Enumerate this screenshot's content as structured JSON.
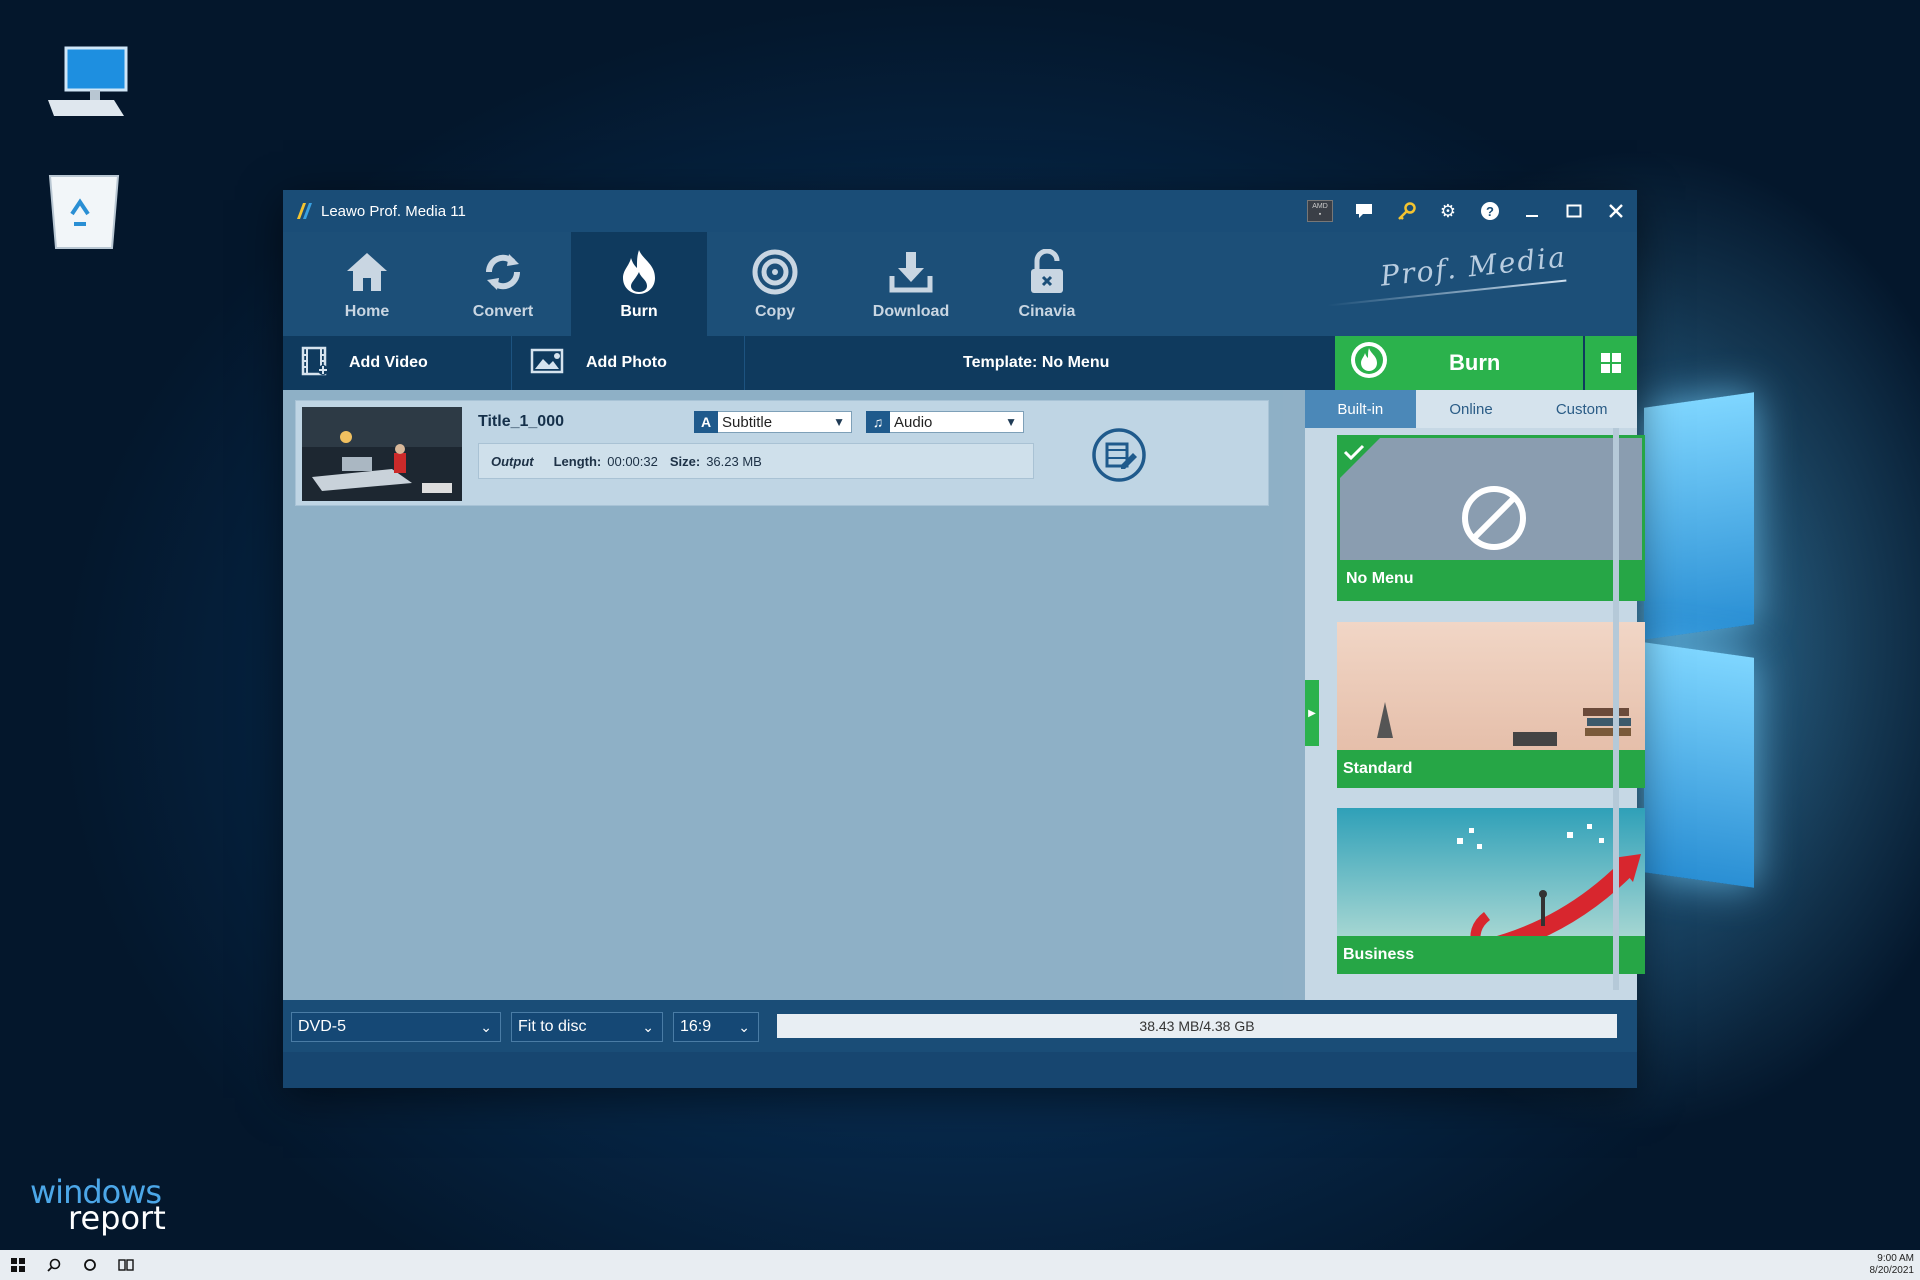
{
  "app": {
    "title": "Leawo Prof. Media 11",
    "brand": "Prof. Media"
  },
  "nav": [
    {
      "label": "Home",
      "icon": "home-icon"
    },
    {
      "label": "Convert",
      "icon": "convert-icon"
    },
    {
      "label": "Burn",
      "icon": "burn-icon",
      "active": true
    },
    {
      "label": "Copy",
      "icon": "copy-icon"
    },
    {
      "label": "Download",
      "icon": "download-icon"
    },
    {
      "label": "Cinavia",
      "icon": "cinavia-icon"
    }
  ],
  "toolbar": {
    "add_video": "Add Video",
    "add_photo": "Add Photo",
    "template": "Template: No Menu",
    "burn": "Burn"
  },
  "title_item": {
    "name": "Title_1_000",
    "subtitle": "Subtitle",
    "audio": "Audio",
    "output_label": "Output",
    "length_label": "Length:",
    "length": "00:00:32",
    "size_label": "Size:",
    "size": "36.23 MB"
  },
  "template_tabs": [
    "Built-in",
    "Online",
    "Custom"
  ],
  "templates": [
    {
      "label": "No Menu",
      "selected": true
    },
    {
      "label": "Standard",
      "selected": false
    },
    {
      "label": "Business",
      "selected": false
    }
  ],
  "bottom": {
    "disc": "DVD-5",
    "fit": "Fit to disc",
    "aspect": "16:9",
    "capacity": "38.43 MB/4.38 GB"
  },
  "taskbar": {
    "time": "9:00 AM",
    "date": "8/20/2021"
  },
  "watermark": {
    "line1": "windows",
    "line2": "report"
  },
  "colors": {
    "accent_green": "#2bb24c",
    "window_blue": "#1c4f78"
  }
}
